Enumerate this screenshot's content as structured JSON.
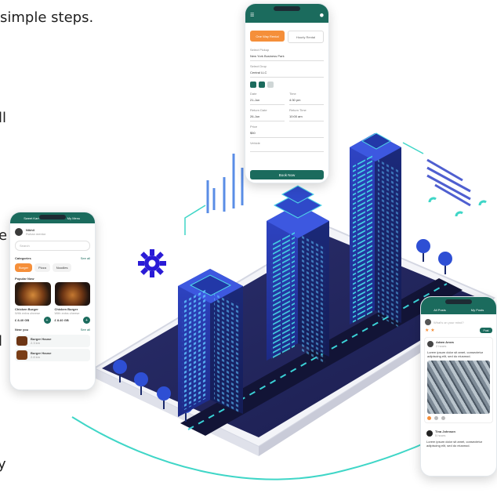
{
  "copy_lines": [
    "simple steps.",
    "ll",
    "e",
    "l",
    "y"
  ],
  "colors": {
    "accent_teal": "#1b6b5d",
    "city_blue": "#2a3aa8",
    "neon": "#3ad1d6",
    "gear": "#2a1bd6"
  },
  "booking_phone": {
    "tabs": [
      "One Way Rental",
      "Hourly Rental"
    ],
    "labels": [
      "Select Pickup",
      "Select Drop",
      "Date",
      "Time",
      "Return Date",
      "Return Time",
      "Price",
      "Vehicle"
    ],
    "values": [
      "New York Business Park",
      "Central LLC",
      "21-Jun",
      "4:30 pm",
      "26-Jun",
      "10:00 am",
      "$50"
    ],
    "cta": "Book Now"
  },
  "food_phone": {
    "tabs": [
      "Sweet Kart",
      "My Menu"
    ],
    "user_name": "Nikhil",
    "user_sub": "Rohan mentor",
    "search_placeholder": "Search",
    "categories_title": "Categories",
    "see_all": "See all",
    "categories": [
      "Burger",
      "Pizza",
      "Noodles"
    ],
    "popular_title": "Popular Now",
    "items": [
      {
        "name": "Chicken Burger",
        "sub": "With extra cheese",
        "price": "£ 8.40 GB"
      },
      {
        "name": "Chicken Burger",
        "sub": "With extra cheese",
        "price": "£ 8.40 GB"
      }
    ],
    "near_title": "Near you",
    "near": [
      {
        "name": "Burger House",
        "sub": "2.3 km"
      },
      {
        "name": "Burger House",
        "sub": "2.8 km"
      }
    ]
  },
  "social_phone": {
    "tabs": [
      "All Posts",
      "My Posts"
    ],
    "status_placeholder": "What's on your mind?",
    "post_button": "Post",
    "posts": [
      {
        "author": "Adam Arora",
        "time": "2 hours",
        "text": "Lorem ipsum dolor sit amet, consectetur adipiscing elit, sed do eiusmod."
      },
      {
        "author": "Tina Johnson",
        "time": "5 hours",
        "text": "Lorem ipsum dolor sit amet, consectetur adipiscing elit, sed do eiusmod."
      }
    ]
  }
}
